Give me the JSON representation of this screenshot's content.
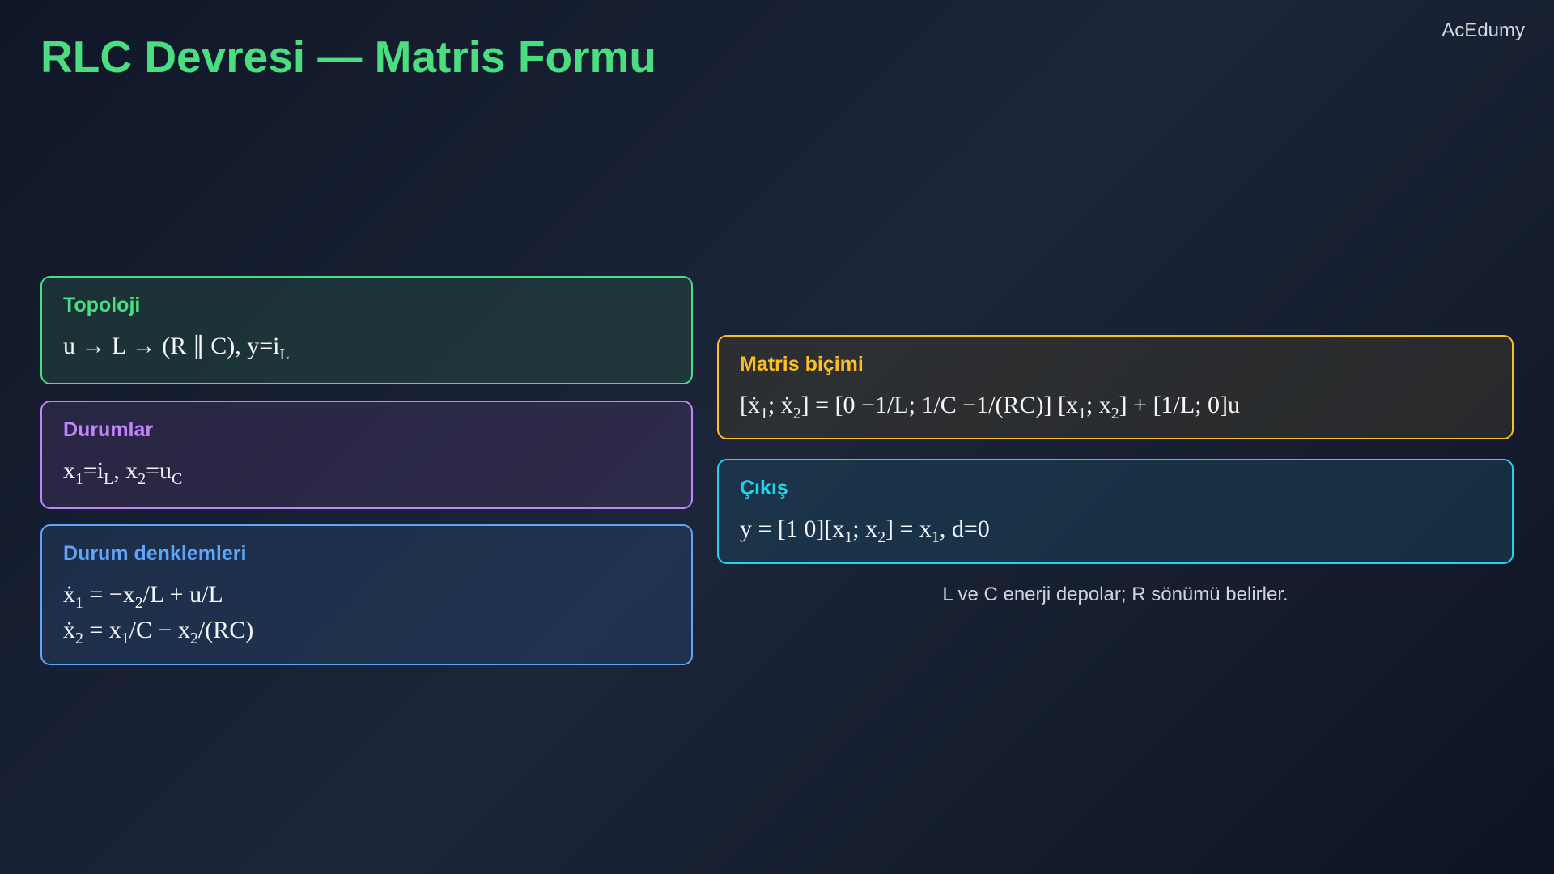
{
  "brand": "AcEdumy",
  "title": "RLC Devresi — Matris Formu",
  "cards": {
    "topology": {
      "label": "Topoloji",
      "formula": [
        "u → L → (R ∥ C),   y=i",
        {
          "sub": "L"
        }
      ]
    },
    "states": {
      "label": "Durumlar",
      "formula": [
        "x",
        {
          "sub": "1"
        },
        "=i",
        {
          "sub": "L"
        },
        ",   x",
        {
          "sub": "2"
        },
        "=u",
        {
          "sub": "C"
        }
      ]
    },
    "state_equations": {
      "label": "Durum denklemleri",
      "lines": [
        [
          "ẋ",
          {
            "sub": "1"
          },
          " = −x",
          {
            "sub": "2"
          },
          "/L + u/L"
        ],
        [
          "ẋ",
          {
            "sub": "2"
          },
          " = x",
          {
            "sub": "1"
          },
          "/C − x",
          {
            "sub": "2"
          },
          "/(RC)"
        ]
      ]
    },
    "matrix": {
      "label": "Matris biçimi",
      "formula": [
        "[ẋ",
        {
          "sub": "1"
        },
        "; ẋ",
        {
          "sub": "2"
        },
        "] = [0   −1/L;   1/C   −1/(RC)] [x",
        {
          "sub": "1"
        },
        "; x",
        {
          "sub": "2"
        },
        "] + [1/L; 0]u"
      ]
    },
    "output": {
      "label": "Çıkış",
      "formula": [
        "y = [1   0][x",
        {
          "sub": "1"
        },
        "; x",
        {
          "sub": "2"
        },
        "] = x",
        {
          "sub": "1"
        },
        ",   d=0"
      ]
    }
  },
  "note": "L ve C enerji depolar; R sönümü belirler.",
  "colors": {
    "title": "#4ade80",
    "topology": "#4ade80",
    "states": "#c084fc",
    "state_equations": "#60a5fa",
    "matrix": "#fbbf24",
    "output": "#22d3ee"
  }
}
